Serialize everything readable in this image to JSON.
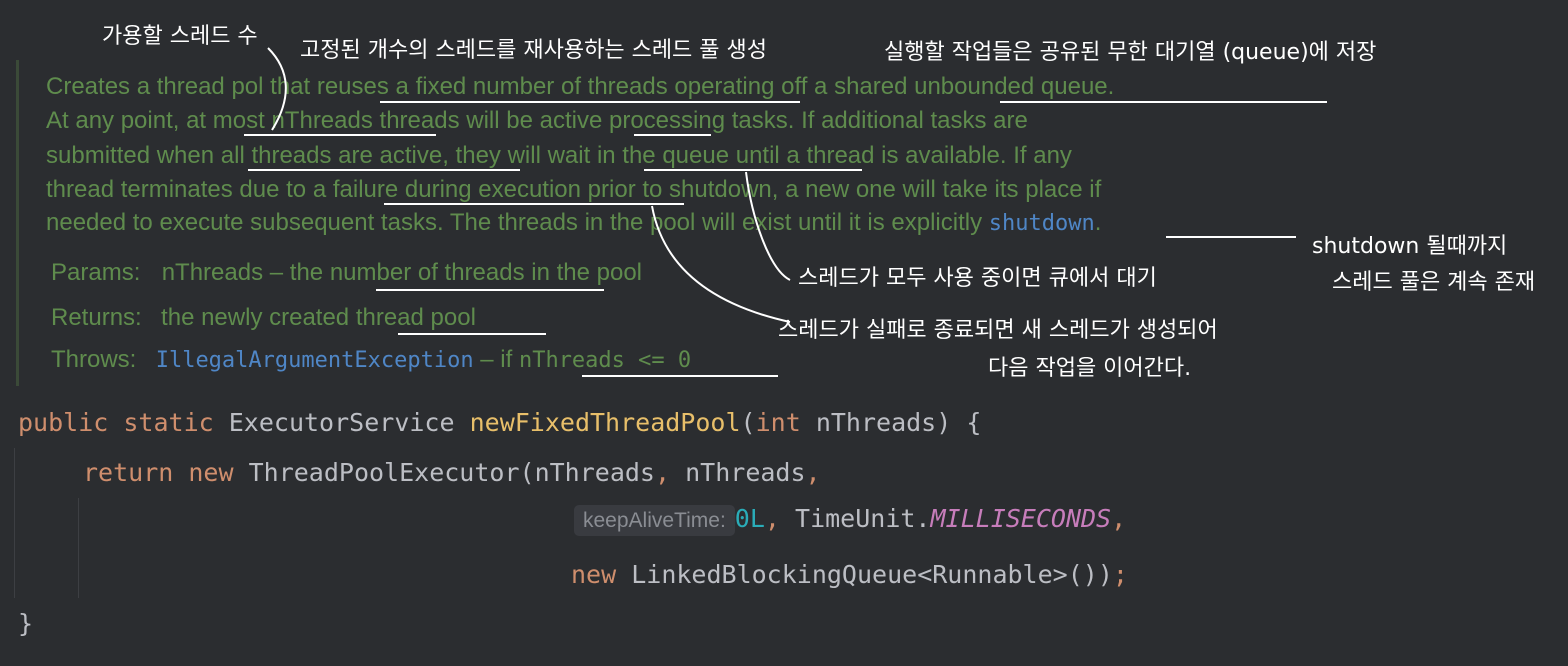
{
  "doc": {
    "line1_a": "Creates a thread p",
    "line1_b": "ol that ",
    "line1_c": "reuses a fixed number of threads",
    "line1_d": " operating off a ",
    "line1_e": "shared unbounded queue",
    "line1_f": ".",
    "line2_a": "At any point, at ",
    "line2_b": "most nThreads",
    "line2_c": " threads will be ",
    "line2_d": "active",
    "line2_e": " processing tasks. If additional tasks are",
    "line3_a": "submitted when ",
    "line3_b": "all threads are active",
    "line3_c": ", they will ",
    "line3_d": "wait in the queue",
    "line3_e": " until a thread is available. If any",
    "line4_a": "thread terminates due to a ",
    "line4_b": "failure during execution",
    "line4_c": " prior to shutdown, a new one will take its place if",
    "line5_a": "needed to execute subsequent tasks. The threads in the pool will exist until it is explicitly ",
    "line5_link": "shutdown",
    "line5_end": ".",
    "params_label": "Params:",
    "params_a": "nThreads – the ",
    "params_b": "number of threads",
    "params_c": " in the pool",
    "returns_label": "Returns:",
    "returns_a": "the newly created ",
    "returns_b": "thread pool",
    "throws_label": "Throws:",
    "throws_link": "IllegalArgumentException",
    "throws_mid": " – if ",
    "throws_code": "nThreads  <=  0"
  },
  "code": {
    "l1_public": "public",
    "l1_static": "static",
    "l1_type": "ExecutorService",
    "l1_name": "newFixedThreadPool",
    "l1_open": "(",
    "l1_int": "int",
    "l1_param": "nThreads",
    "l1_close": ") {",
    "l2_return": "return",
    "l2_new": "new",
    "l2_class": "ThreadPoolExecutor(nThreads",
    "l2_comma1": ",",
    "l2_arg2": "nThreads",
    "l2_comma2": ",",
    "l3_hint": "keepAliveTime:",
    "l3_num": "0L",
    "l3_comma": ",",
    "l3_unit": "TimeUnit.",
    "l3_const": "MILLISECONDS",
    "l3_comma2": ",",
    "l4_new": "new",
    "l4_class": "LinkedBlockingQueue<Runnable>()",
    "l4_close": ")",
    "l4_semi": ";",
    "l5_brace": "}"
  },
  "annotations": {
    "a1": "가용할 스레드 수",
    "a2": "고정된 개수의 스레드를 재사용하는 스레드 풀 생성",
    "a3": "실행할 작업들은 공유된 무한 대기열 (queue)에 저장",
    "a4_l1": "shutdown 될때까지",
    "a4_l2": "스레드 풀은 계속 존재",
    "a5": "스레드가 모두 사용 중이면 큐에서 대기",
    "a6_l1": "스레드가 실패로 종료되면 새 스레드가 생성되어",
    "a6_l2": "다음 작업을 이어간다."
  },
  "colors": {
    "background": "#2b2d30",
    "doc_text": "#5f8c4d",
    "keyword": "#cf8e6d",
    "method": "#56a8f5",
    "number": "#2aacb8",
    "constant": "#c77dbb",
    "link": "#4f86c6"
  }
}
